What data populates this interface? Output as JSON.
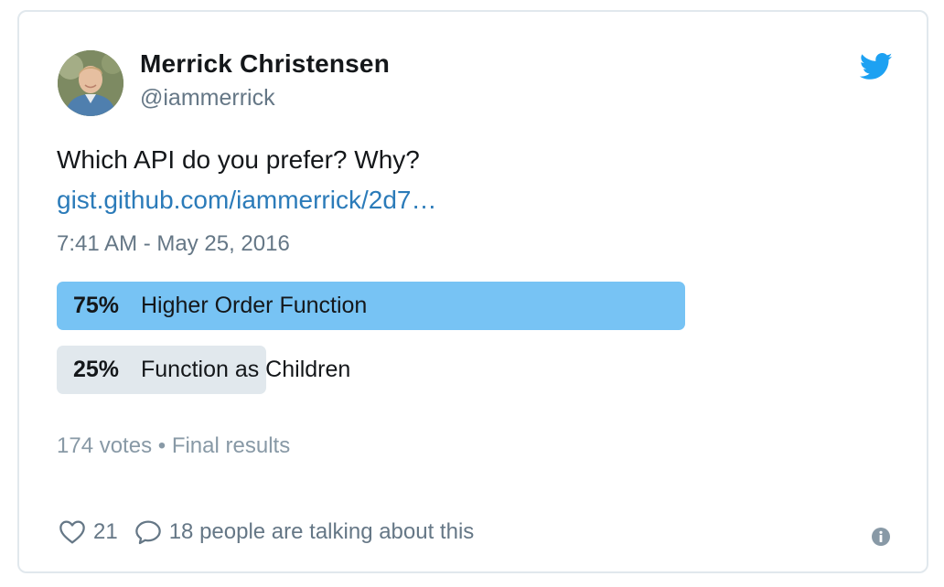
{
  "author": {
    "name": "Merrick Christensen",
    "handle": "@iammerrick",
    "avatar_icon": "avatar-photo"
  },
  "brand": {
    "logo_icon": "twitter-bird-icon",
    "color": "#1da1f2"
  },
  "tweet": {
    "text": "Which API do you prefer? Why?",
    "link": "gist.github.com/iammerrick/2d7…",
    "timestamp": "7:41 AM - May 25, 2016"
  },
  "poll": {
    "options": [
      {
        "percent_label": "75%",
        "percent": 75,
        "label": "Higher Order Function",
        "winner": true
      },
      {
        "percent_label": "25%",
        "percent": 25,
        "label": "Function as Children",
        "winner": false
      }
    ],
    "meta": "174 votes • Final results",
    "colors": {
      "winner": "#77c3f4",
      "other": "#e1e8ed"
    }
  },
  "footer": {
    "likes": "21",
    "talking": "18 people are talking about this",
    "like_icon": "heart-icon",
    "reply_icon": "reply-bubble-icon",
    "info_icon": "info-icon"
  }
}
